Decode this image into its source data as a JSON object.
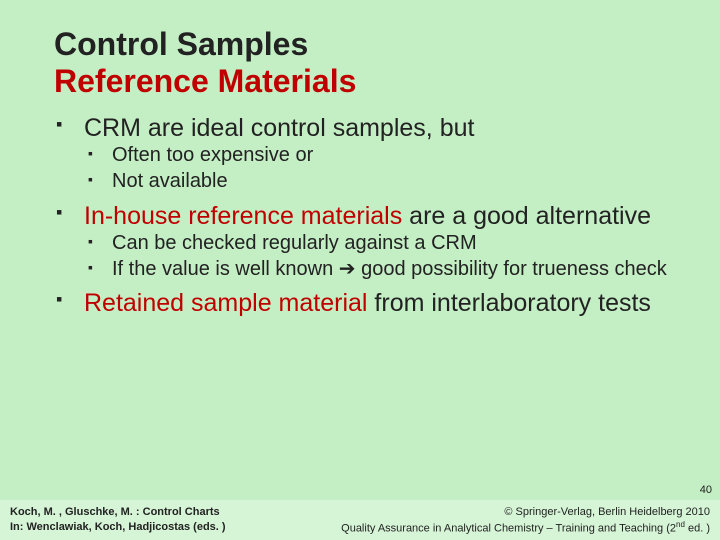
{
  "title": {
    "line1": "Control Samples",
    "line2": "Reference Materials"
  },
  "bullets": {
    "b1": {
      "text": "CRM are ideal control samples, but",
      "sub": [
        "Often too expensive or",
        "Not available"
      ]
    },
    "b2": {
      "highlight": "In-house reference materials",
      "rest": " are a good alternative",
      "sub": [
        "Can be checked regularly against a CRM",
        "If the value is well known ➔ good possibility for trueness check"
      ]
    },
    "b3": {
      "highlight": "Retained sample material",
      "rest": " from interlaboratory tests"
    }
  },
  "page_number": "40",
  "footer": {
    "left_line1": "Koch, M. , Gluschke, M. : Control Charts",
    "left_line2": "In:  Wenclawiak, Koch, Hadjicostas (eds. )",
    "right_line1": "© Springer-Verlag, Berlin Heidelberg 2010",
    "right_line2_a": "Quality Assurance in Analytical Chemistry – Training and Teaching (2",
    "right_line2_sup": "nd",
    "right_line2_b": " ed. )"
  }
}
